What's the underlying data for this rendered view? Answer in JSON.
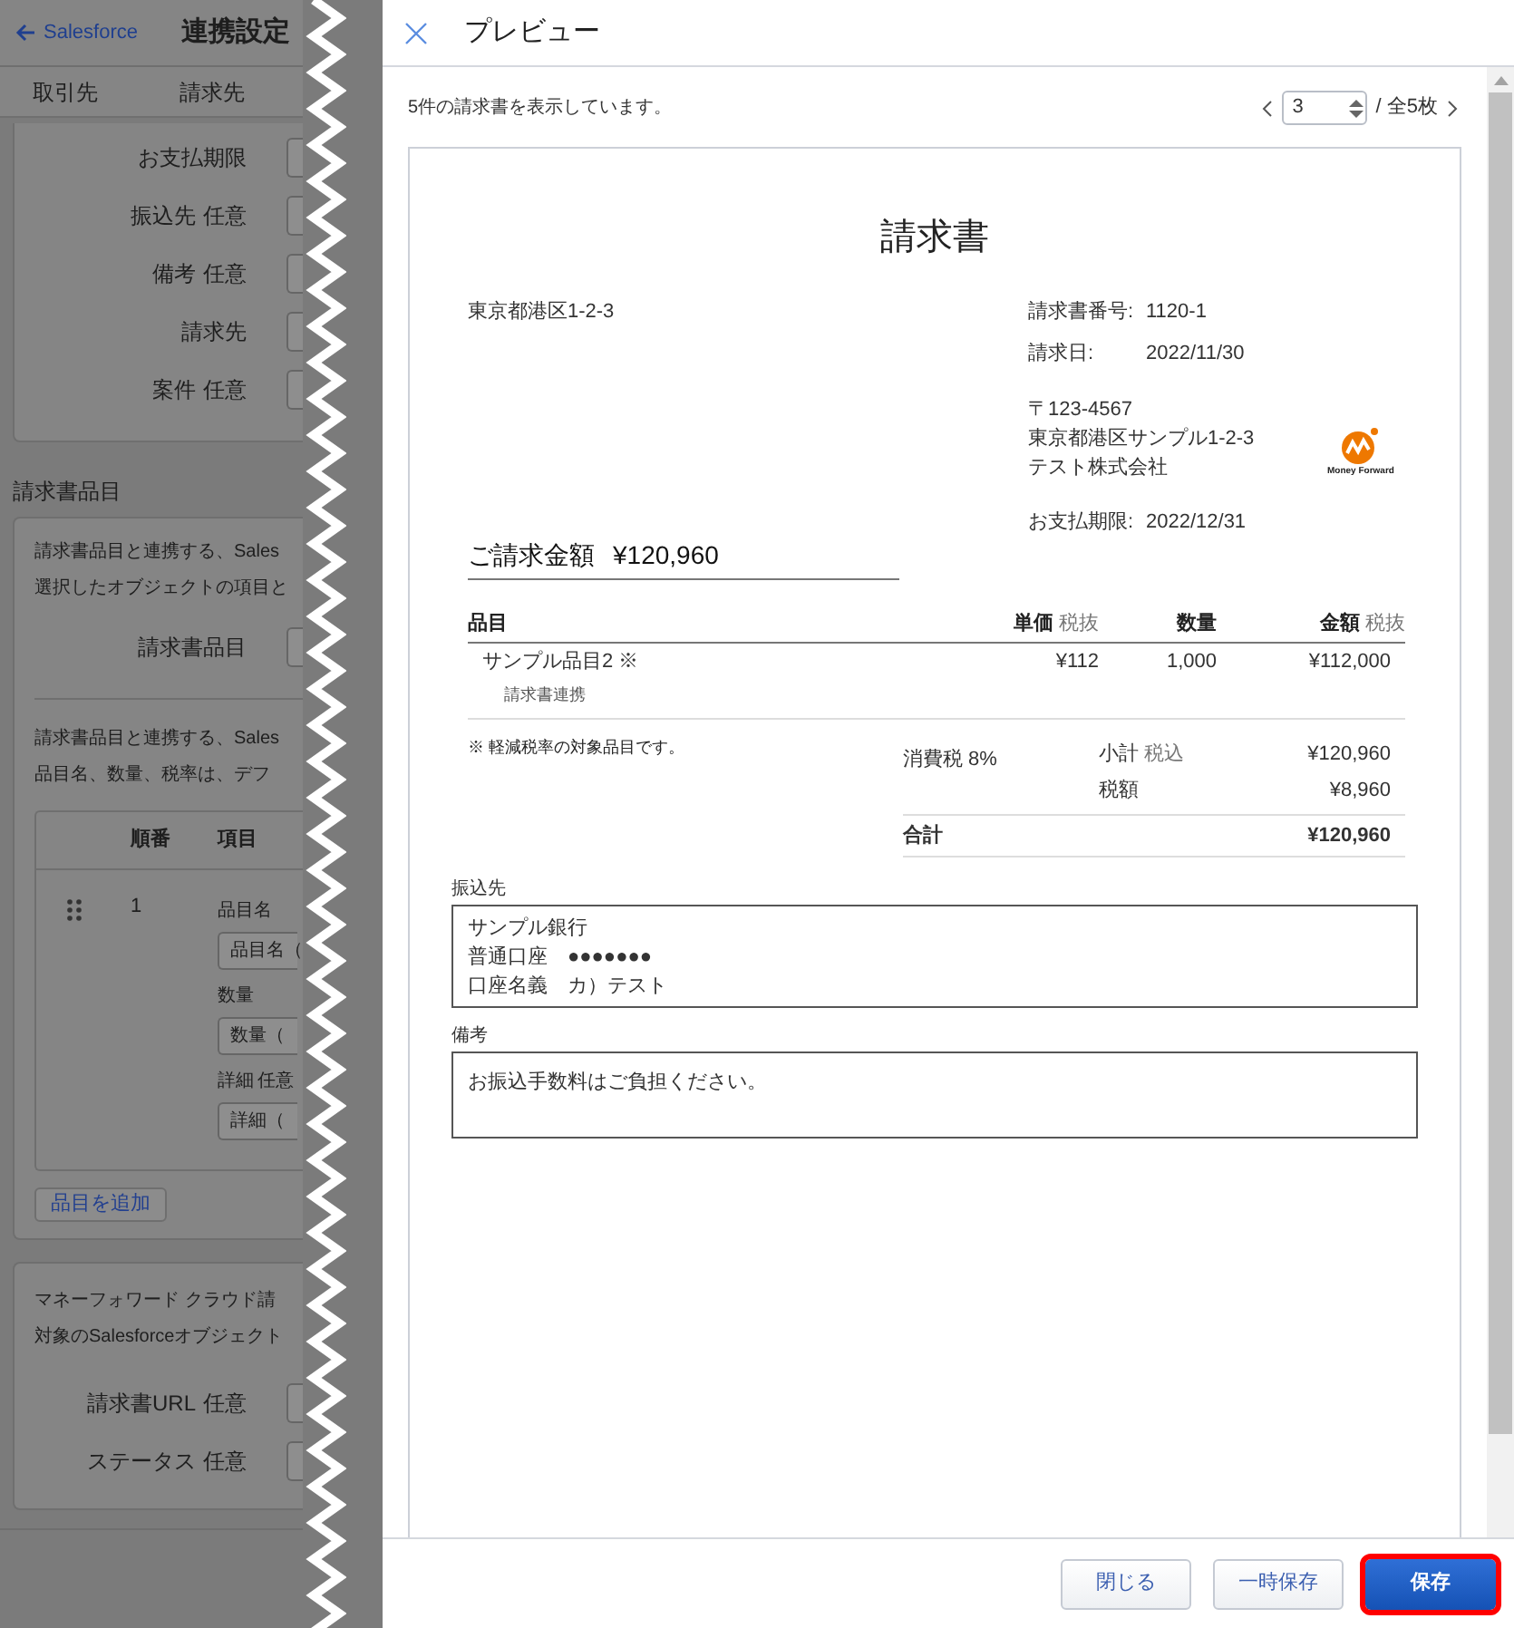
{
  "background_page": {
    "back_link": "Salesforce",
    "title": "連携設定",
    "tabs": [
      "取引先",
      "請求先"
    ],
    "fields_top": [
      {
        "label": "お支払期限"
      },
      {
        "label": "振込先",
        "tag": "任意"
      },
      {
        "label": "備考",
        "tag": "任意"
      },
      {
        "label": "請求先"
      },
      {
        "label": "案件",
        "tag": "任意"
      }
    ],
    "section_title": "請求書品目",
    "items_card": {
      "intro": [
        "請求書品目と連携する、Sales",
        "選択したオブジェクトの項目と"
      ],
      "field": {
        "label": "請求書品目"
      },
      "intro2": [
        "請求書品目と連携する、Sales",
        "品目名、数量、税率は、デフ"
      ],
      "table_columns": [
        "順番",
        "項目"
      ],
      "row": {
        "number": "1",
        "fields": [
          {
            "label": "品目名",
            "value": "品目名（"
          },
          {
            "label": "数量",
            "value": "数量（"
          },
          {
            "label": "詳細",
            "tag": "任意",
            "value": "詳細（"
          }
        ]
      },
      "add_button": "品目を追加"
    },
    "status_card": {
      "intro": [
        "マネーフォワード クラウド請",
        "対象のSalesforceオブジェクト"
      ],
      "fields": [
        {
          "label": "請求書URL",
          "tag": "任意"
        },
        {
          "label": "ステータス",
          "tag": "任意"
        }
      ]
    }
  },
  "modal": {
    "title": "プレビュー",
    "info": "5件の請求書を表示しています。",
    "pager": {
      "value": "3",
      "total": "/ 全5枚"
    },
    "invoice": {
      "title": "請求書",
      "sender_address": "東京都港区1-2-3",
      "meta": [
        {
          "label": "請求書番号:",
          "value": "1120-1"
        },
        {
          "label": "請求日:",
          "value": "2022/11/30"
        }
      ],
      "recipient": [
        "〒123-4567",
        "東京都港区サンプル1-2-3",
        "テスト株式会社"
      ],
      "logo_text": "Money Forward",
      "due": {
        "label": "お支払期限:",
        "value": "2022/12/31"
      },
      "amount_label": "ご請求金額",
      "amount": "¥120,960",
      "columns": [
        {
          "label": "品目"
        },
        {
          "label": "単価",
          "sub": "税抜"
        },
        {
          "label": "数量"
        },
        {
          "label": "金額",
          "sub": "税抜"
        }
      ],
      "lines": [
        {
          "name": "サンプル品目2 ※",
          "price": "¥112",
          "qty": "1,000",
          "amount": "¥112,000",
          "detail": "請求書連携"
        }
      ],
      "note": "※ 軽減税率の対象品目です。",
      "tax_label": "消費税 8%",
      "summary": [
        {
          "label": "小計",
          "sub": "税込",
          "value": "¥120,960"
        },
        {
          "label": "税額",
          "value": "¥8,960"
        }
      ],
      "total": {
        "label": "合計",
        "value": "¥120,960"
      },
      "bank": {
        "label": "振込先",
        "lines": [
          "サンプル銀行",
          "普通口座　●●●●●●●",
          "口座名義　カ）テスト"
        ]
      },
      "remarks": {
        "label": "備考",
        "text": "お振込手数料はご負担ください。"
      }
    },
    "buttons": [
      {
        "label": "閉じる",
        "kind": "secondary",
        "highlighted": false
      },
      {
        "label": "一時保存",
        "kind": "secondary",
        "highlighted": false
      },
      {
        "label": "保存",
        "kind": "primary",
        "highlighted": true
      }
    ]
  }
}
